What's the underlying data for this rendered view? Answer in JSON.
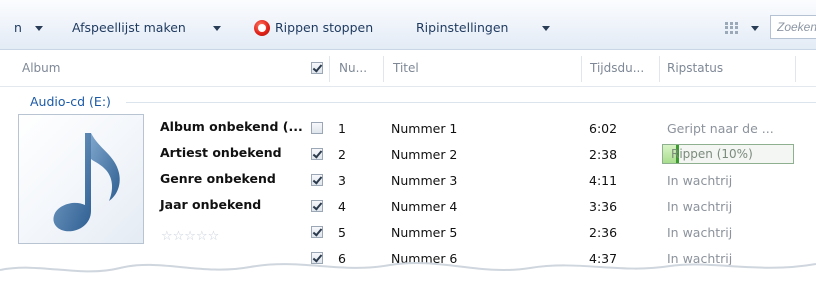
{
  "toolbar": {
    "left_fragment": "n",
    "playlist_label": "Afspeellijst maken",
    "stop_label": "Rippen stoppen",
    "settings_label": "Ripinstellingen",
    "search_placeholder": "Zoeken"
  },
  "columns": {
    "album": "Album",
    "number": "Nu...",
    "title": "Titel",
    "duration": "Tijdsdu...",
    "status": "Ripstatus"
  },
  "group": {
    "label": "Audio-cd (E:)",
    "album": "Album onbekend (...",
    "artist": "Artiest onbekend",
    "genre": "Genre onbekend",
    "year": "Jaar onbekend",
    "rating": {
      "value": 0,
      "max": 5,
      "symbols": "☆☆☆☆☆"
    }
  },
  "tracks": [
    {
      "checked": false,
      "number": "1",
      "title": "Nummer 1",
      "duration": "6:02",
      "status": "Geript naar de ..."
    },
    {
      "checked": true,
      "number": "2",
      "title": "Nummer 2",
      "duration": "2:38",
      "status": "Rippen (10%)",
      "progress": 0.1
    },
    {
      "checked": true,
      "number": "3",
      "title": "Nummer 3",
      "duration": "4:11",
      "status": "In wachtrij"
    },
    {
      "checked": true,
      "number": "4",
      "title": "Nummer 4",
      "duration": "3:36",
      "status": "In wachtrij"
    },
    {
      "checked": true,
      "number": "5",
      "title": "Nummer 5",
      "duration": "2:36",
      "status": "In wachtrij"
    },
    {
      "checked": true,
      "number": "6",
      "title": "Nummer 6",
      "duration": "4:37",
      "status": "In wachtrij"
    }
  ],
  "colors": {
    "group_label": "#1c5aa6",
    "progress_fill": "#a9dd8d",
    "stop_icon": "#e2231a"
  },
  "icons": {
    "stop": "stop-rip-icon",
    "view": "view-options-icon",
    "album_art": "music-note-icon"
  }
}
